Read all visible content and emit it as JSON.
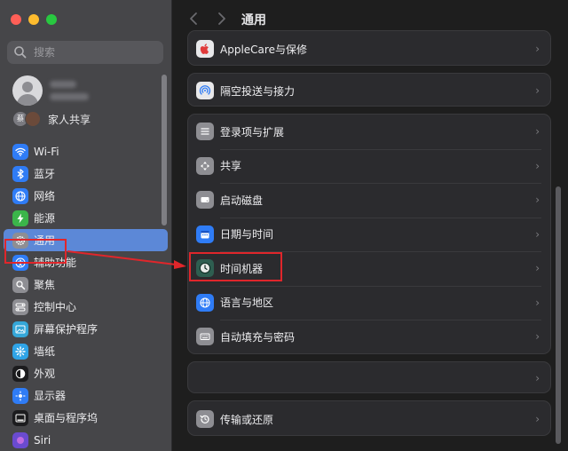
{
  "sidebar": {
    "search_placeholder": "搜索",
    "family_sharing": "家人共享",
    "family_avatar_initial": "蔡",
    "items": [
      {
        "label": "Wi-Fi",
        "icon": "wifi-icon",
        "color": "#2f7cf6"
      },
      {
        "label": "蓝牙",
        "icon": "bluetooth-icon",
        "color": "#2f7cf6"
      },
      {
        "label": "网络",
        "icon": "globe-icon",
        "color": "#2f7cf6"
      },
      {
        "label": "能源",
        "icon": "bolt-icon",
        "color": "#3bb54a"
      },
      {
        "label": "通用",
        "icon": "gear-icon",
        "color": "#8e8e93"
      },
      {
        "label": "辅助功能",
        "icon": "accessibility-icon",
        "color": "#2f7cf6"
      },
      {
        "label": "聚焦",
        "icon": "spotlight-icon",
        "color": "#8e8e93"
      },
      {
        "label": "控制中心",
        "icon": "control-center-icon",
        "color": "#8e8e93"
      },
      {
        "label": "屏幕保护程序",
        "icon": "screensaver-icon",
        "color": "#35a7d8"
      },
      {
        "label": "墙纸",
        "icon": "wallpaper-icon",
        "color": "#2fa4e7"
      },
      {
        "label": "外观",
        "icon": "appearance-icon",
        "color": "#1c1c1e"
      },
      {
        "label": "显示器",
        "icon": "display-icon",
        "color": "#2f7cf6"
      },
      {
        "label": "桌面与程序坞",
        "icon": "dock-icon",
        "color": "#1c1c1e"
      },
      {
        "label": "Siri",
        "icon": "siri-icon",
        "color": "#6a4bd0"
      }
    ]
  },
  "main": {
    "title": "通用",
    "group1": [
      {
        "label": "AppleCare与保修",
        "icon": "apple-icon",
        "color": "#e03a3a"
      }
    ],
    "group2": [
      {
        "label": "隔空投送与接力",
        "icon": "airdrop-icon",
        "color": "#e8e8ea"
      }
    ],
    "group3": [
      {
        "label": "登录项与扩展",
        "icon": "list-icon",
        "color": "#8e8e93"
      },
      {
        "label": "共享",
        "icon": "sharing-icon",
        "color": "#8e8e93"
      },
      {
        "label": "启动磁盘",
        "icon": "disk-icon",
        "color": "#8e8e93"
      },
      {
        "label": "日期与时间",
        "icon": "calendar-icon",
        "color": "#2f7cf6"
      },
      {
        "label": "时间机器",
        "icon": "time-machine-icon",
        "color": "#2e5e50"
      },
      {
        "label": "语言与地区",
        "icon": "globe-icon",
        "color": "#2f7cf6"
      },
      {
        "label": "自动填充与密码",
        "icon": "keyboard-icon",
        "color": "#8e8e93"
      }
    ],
    "group5": [
      {
        "label": "传输或还原",
        "icon": "restore-icon",
        "color": "#8e8e93"
      }
    ]
  },
  "annotation_color": "#e0262b"
}
